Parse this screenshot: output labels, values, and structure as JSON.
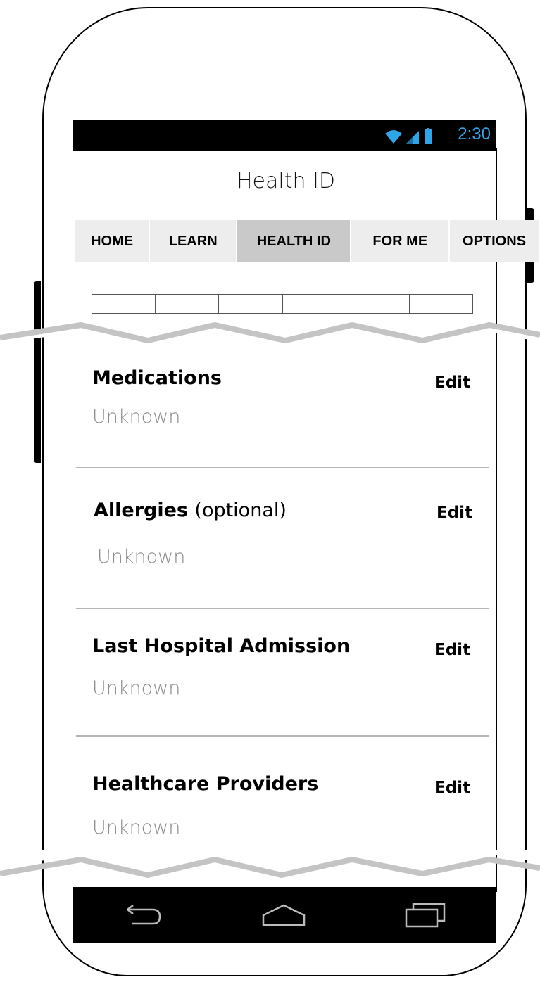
{
  "status_bar": {
    "time": "2:30",
    "icons": [
      "wifi-icon",
      "signal-icon",
      "battery-icon"
    ],
    "accent_color": "#2fa4e7"
  },
  "app": {
    "title": "Health ID"
  },
  "tabs": [
    {
      "label": "HOME",
      "active": false
    },
    {
      "label": "LEARN",
      "active": false
    },
    {
      "label": "HEALTH ID",
      "active": true
    },
    {
      "label": "FOR ME",
      "active": false
    },
    {
      "label": "OPTIONS",
      "active": false
    }
  ],
  "progress": {
    "segments": 6
  },
  "sections": [
    {
      "title": "Medications",
      "subtitle": "",
      "edit_label": "Edit",
      "value": "Unknown"
    },
    {
      "title": "Allergies",
      "subtitle": "(optional)",
      "edit_label": "Edit",
      "value": "Unknown"
    },
    {
      "title": "Last Hospital Admission",
      "subtitle": "",
      "edit_label": "Edit",
      "value": "Unknown"
    },
    {
      "title": "Healthcare Providers",
      "subtitle": "",
      "edit_label": "Edit",
      "value": "Unknown"
    }
  ],
  "nav_bar": {
    "icons": [
      "back-icon",
      "home-icon",
      "recent-apps-icon"
    ]
  }
}
